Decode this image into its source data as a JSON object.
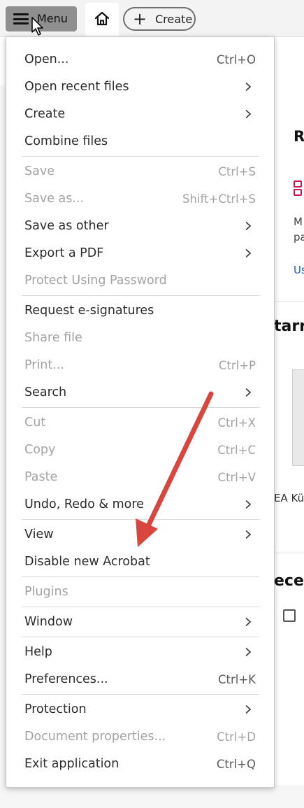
{
  "topbar": {
    "menu_label": "Menu",
    "create_label": "Create"
  },
  "background": {
    "heading_fragment": "R",
    "desc_line1": "M",
    "desc_line2": "pa",
    "link_fragment": "Us",
    "starred_fragment": "tarre",
    "file_fragment": "EA Kü",
    "recent_fragment": "ecen"
  },
  "menu": {
    "items": [
      {
        "label": "Open...",
        "shortcut": "Ctrl+O",
        "submenu": false,
        "enabled": true
      },
      {
        "label": "Open recent files",
        "shortcut": "",
        "submenu": true,
        "enabled": true
      },
      {
        "label": "Create",
        "shortcut": "",
        "submenu": true,
        "enabled": true
      },
      {
        "label": "Combine files",
        "shortcut": "",
        "submenu": false,
        "enabled": true
      },
      {
        "label": "Save",
        "shortcut": "Ctrl+S",
        "submenu": false,
        "enabled": false
      },
      {
        "label": "Save as...",
        "shortcut": "Shift+Ctrl+S",
        "submenu": false,
        "enabled": false
      },
      {
        "label": "Save as other",
        "shortcut": "",
        "submenu": true,
        "enabled": true
      },
      {
        "label": "Export a PDF",
        "shortcut": "",
        "submenu": true,
        "enabled": true
      },
      {
        "label": "Protect Using Password",
        "shortcut": "",
        "submenu": false,
        "enabled": false
      },
      {
        "label": "Request e-signatures",
        "shortcut": "",
        "submenu": false,
        "enabled": true
      },
      {
        "label": "Share file",
        "shortcut": "",
        "submenu": false,
        "enabled": false
      },
      {
        "label": "Print...",
        "shortcut": "Ctrl+P",
        "submenu": false,
        "enabled": false
      },
      {
        "label": "Search",
        "shortcut": "",
        "submenu": true,
        "enabled": true
      },
      {
        "label": "Cut",
        "shortcut": "Ctrl+X",
        "submenu": false,
        "enabled": false
      },
      {
        "label": "Copy",
        "shortcut": "Ctrl+C",
        "submenu": false,
        "enabled": false
      },
      {
        "label": "Paste",
        "shortcut": "Ctrl+V",
        "submenu": false,
        "enabled": false
      },
      {
        "label": "Undo, Redo & more",
        "shortcut": "",
        "submenu": true,
        "enabled": true
      },
      {
        "label": "View",
        "shortcut": "",
        "submenu": true,
        "enabled": true
      },
      {
        "label": "Disable new Acrobat",
        "shortcut": "",
        "submenu": false,
        "enabled": true
      },
      {
        "label": "Plugins",
        "shortcut": "",
        "submenu": false,
        "enabled": false
      },
      {
        "label": "Window",
        "shortcut": "",
        "submenu": true,
        "enabled": true
      },
      {
        "label": "Help",
        "shortcut": "",
        "submenu": true,
        "enabled": true
      },
      {
        "label": "Preferences...",
        "shortcut": "Ctrl+K",
        "submenu": false,
        "enabled": true
      },
      {
        "label": "Protection",
        "shortcut": "",
        "submenu": true,
        "enabled": true
      },
      {
        "label": "Document properties...",
        "shortcut": "Ctrl+D",
        "submenu": false,
        "enabled": false
      },
      {
        "label": "Exit application",
        "shortcut": "Ctrl+Q",
        "submenu": false,
        "enabled": true
      }
    ]
  },
  "colors": {
    "annotation_arrow": "#d9463e",
    "disabled_text": "#a3a3a3",
    "link": "#1a5cc8"
  },
  "icons": [
    "hamburger-icon",
    "pointer-cursor-icon",
    "home-icon",
    "plus-icon",
    "chevron-right-icon"
  ]
}
